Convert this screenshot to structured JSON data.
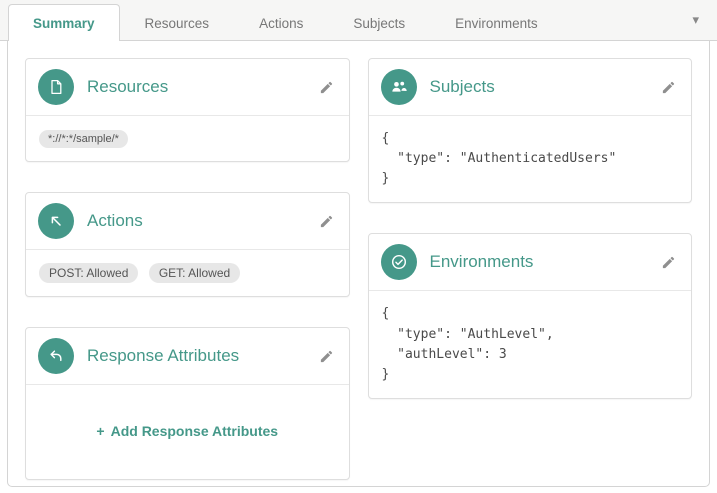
{
  "colors": {
    "accent": "#459889",
    "tab_inactive_text": "#777777",
    "pill_background": "#e7e7e7"
  },
  "tab_bar": {
    "tabs": [
      {
        "label": "Summary",
        "active": true
      },
      {
        "label": "Resources",
        "active": false
      },
      {
        "label": "Actions",
        "active": false
      },
      {
        "label": "Subjects",
        "active": false
      },
      {
        "label": "Environments",
        "active": false
      }
    ],
    "overflow_caret": "▾"
  },
  "cards": {
    "resources": {
      "icon": "file-icon",
      "title": "Resources",
      "pattern": "*://*:*/sample/*"
    },
    "actions": {
      "icon": "arrow-up-left-icon",
      "title": "Actions",
      "pills": [
        "POST: Allowed",
        "GET: Allowed"
      ]
    },
    "response_attributes": {
      "icon": "reply-arrow-icon",
      "title": "Response Attributes",
      "plus": "+",
      "add_label": "Add Response Attributes"
    },
    "subjects": {
      "icon": "users-icon",
      "title": "Subjects",
      "code": "{\n  \"type\": \"AuthenticatedUsers\"\n}"
    },
    "environments": {
      "icon": "check-circle-icon",
      "title": "Environments",
      "code": "{\n  \"type\": \"AuthLevel\",\n  \"authLevel\": 3\n}"
    }
  }
}
